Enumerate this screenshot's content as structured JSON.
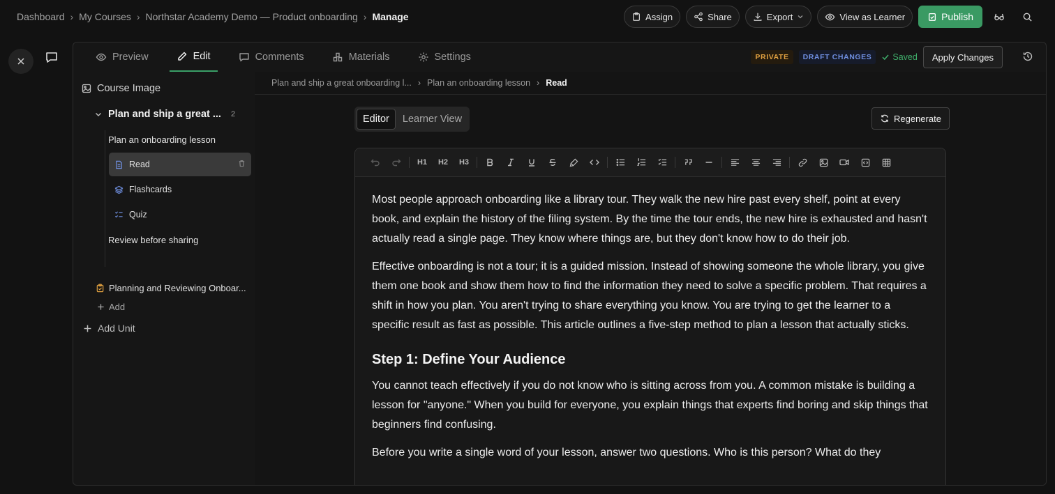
{
  "breadcrumb": {
    "items": [
      "Dashboard",
      "My Courses",
      "Northstar Academy Demo — Product onboarding"
    ],
    "current": "Manage"
  },
  "toolbar": {
    "assign": "Assign",
    "share": "Share",
    "export": "Export",
    "view_as_learner": "View as Learner",
    "publish": "Publish"
  },
  "tabs": [
    {
      "label": "Preview",
      "icon": "eye-icon"
    },
    {
      "label": "Edit",
      "icon": "pencil-icon",
      "active": true
    },
    {
      "label": "Comments",
      "icon": "comment-icon"
    },
    {
      "label": "Materials",
      "icon": "materials-icon"
    },
    {
      "label": "Settings",
      "icon": "gear-icon"
    }
  ],
  "status": {
    "private": "PRIVATE",
    "draft": "DRAFT CHANGES",
    "saved": "Saved",
    "apply": "Apply Changes"
  },
  "sidebar": {
    "course_image": "Course Image",
    "unit_title": "Plan and ship a great ...",
    "unit_count": "2",
    "lesson1": "Plan an onboarding lesson",
    "items": [
      "Read",
      "Flashcards",
      "Quiz"
    ],
    "lesson2": "Review before sharing",
    "assessment": "Planning and Reviewing Onboar...",
    "add": "Add",
    "add_unit": "Add Unit"
  },
  "content_breadcrumb": {
    "items": [
      "Plan and ship a great onboarding l...",
      "Plan an onboarding lesson"
    ],
    "current": "Read"
  },
  "view_toggle": {
    "editor": "Editor",
    "learner": "Learner View"
  },
  "regenerate": "Regenerate",
  "editor_tools": {
    "h1": "H1",
    "h2": "H2",
    "h3": "H3"
  },
  "article": {
    "p1": "Most people approach onboarding like a library tour. They walk the new hire past every shelf, point at every book, and explain the history of the filing system. By the time the tour ends, the new hire is exhausted and hasn't actually read a single page. They know where things are, but they don't know how to do their job.",
    "p2": "Effective onboarding is not a tour; it is a guided mission. Instead of showing someone the whole library, you give them one book and show them how to find the information they need to solve a specific problem. That requires a shift in how you plan. You aren't trying to share everything you know. You are trying to get the learner to a specific result as fast as possible. This article outlines a five-step method to plan a lesson that actually sticks.",
    "h_step1": "Step 1: Define Your Audience",
    "p3": "You cannot teach effectively if you do not know who is sitting across from you. A common mistake is building a lesson for \"anyone.\" When you build for everyone, you explain things that experts find boring and skip things that beginners find confusing.",
    "p4": "Before you write a single word of your lesson, answer two questions. Who is this person? What do they"
  },
  "colors": {
    "accent_green": "#3a9a63",
    "private": "#e0a040",
    "draft": "#6f8fe0"
  }
}
